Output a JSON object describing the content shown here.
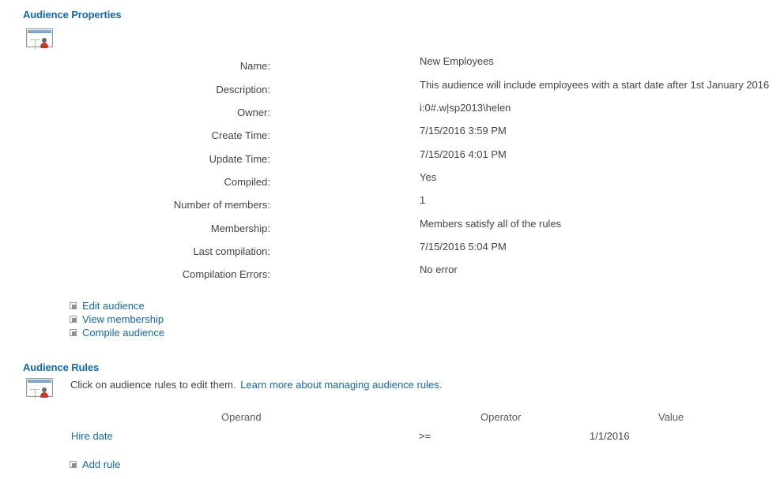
{
  "sections": {
    "properties": {
      "heading": "Audience Properties",
      "icon": "audience-icon"
    },
    "rules": {
      "heading": "Audience Rules",
      "icon": "audience-icon",
      "intro_text": "Click on audience rules to edit them.",
      "intro_link": "Learn more about managing audience rules."
    }
  },
  "properties": [
    {
      "label": "Name:",
      "value": "New Employees"
    },
    {
      "label": "Description:",
      "value": "This audience will include employees with a start date after 1st January 2016"
    },
    {
      "label": "Owner:",
      "value": "i:0#.w|sp2013\\helen"
    },
    {
      "label": "Create Time:",
      "value": "7/15/2016 3:59 PM"
    },
    {
      "label": "Update Time:",
      "value": "7/15/2016 4:01 PM"
    },
    {
      "label": "Compiled:",
      "value": "Yes"
    },
    {
      "label": "Number of members:",
      "value": "1"
    },
    {
      "label": "Membership:",
      "value": "Members satisfy all of the rules"
    },
    {
      "label": "Last compilation:",
      "value": "7/15/2016 5:04 PM"
    },
    {
      "label": "Compilation Errors:",
      "value": "No error"
    }
  ],
  "actions": [
    {
      "label": "Edit audience",
      "icon": "square-bullet-icon"
    },
    {
      "label": "View membership",
      "icon": "square-bullet-icon"
    },
    {
      "label": "Compile audience",
      "icon": "square-bullet-icon"
    }
  ],
  "rules_table": {
    "columns": [
      "Operand",
      "Operator",
      "Value"
    ],
    "rows": [
      {
        "operand": "Hire date",
        "operator": ">=",
        "value": "1/1/2016"
      }
    ],
    "add_rule_label": "Add rule",
    "add_rule_icon": "square-bullet-icon"
  },
  "colors": {
    "heading": "#1268b3",
    "link": "#1268b3",
    "text": "#444444",
    "background": "#ffffff"
  }
}
